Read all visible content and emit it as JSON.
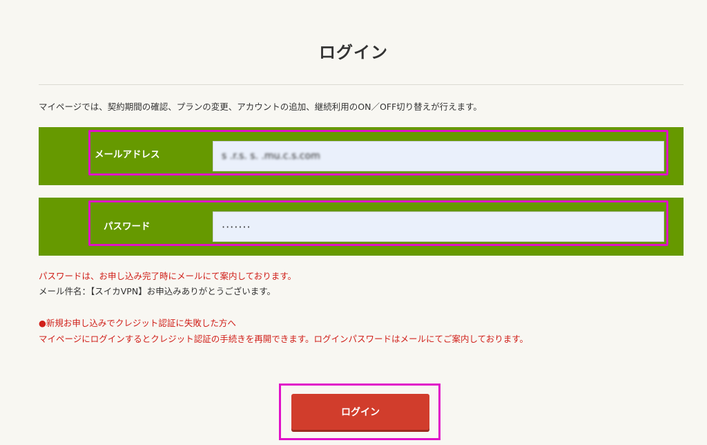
{
  "page": {
    "title": "ログイン",
    "intro": "マイページでは、契約期間の確認、プランの変更、アカウントの追加、継続利用のON／OFF切り替えが行えます。"
  },
  "form": {
    "email": {
      "label": "メールアドレス",
      "value": "s .r.s. s.  .mu.c.s.com"
    },
    "password": {
      "label": "パスワード",
      "value": "·······"
    }
  },
  "notes": {
    "password_mail": "パスワードは、お申し込み完了時にメールにて案内しております。",
    "mail_subject": "メール件名：【スイカVPN】お申込みありがとうございます。",
    "credit_fail_title": "●新規お申し込みでクレジット認証に失敗した方へ",
    "credit_fail_body": "マイページにログインするとクレジット認証の手続きを再開できます。ログインパスワードはメールにてご案内しております。"
  },
  "actions": {
    "login_label": "ログイン"
  },
  "colors": {
    "background": "#f8f7f2",
    "field_row": "#669900",
    "highlight": "#e010c8",
    "button": "#d13d2c",
    "note_red": "#d0201a"
  }
}
